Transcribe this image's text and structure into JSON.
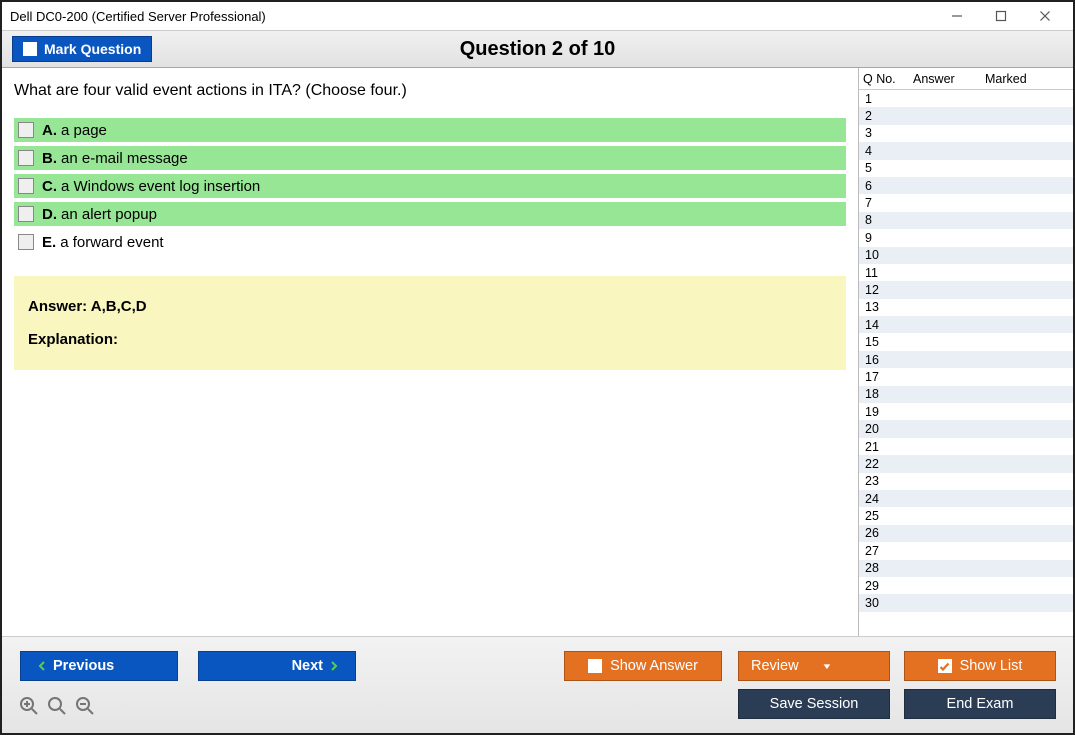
{
  "window": {
    "title": "Dell DC0-200 (Certified Server Professional)"
  },
  "header": {
    "mark_label": "Mark Question",
    "counter": "Question 2 of 10"
  },
  "question": {
    "text": "What are four valid event actions in ITA? (Choose four.)",
    "choices": [
      {
        "letter": "A.",
        "text": "a page",
        "correct": true
      },
      {
        "letter": "B.",
        "text": "an e-mail message",
        "correct": true
      },
      {
        "letter": "C.",
        "text": "a Windows event log insertion",
        "correct": true
      },
      {
        "letter": "D.",
        "text": "an alert popup",
        "correct": true
      },
      {
        "letter": "E.",
        "text": "a forward event",
        "correct": false
      }
    ],
    "answer_label": "Answer: A,B,C,D",
    "explanation_label": "Explanation:"
  },
  "sidebar": {
    "head_q": "Q No.",
    "head_a": "Answer",
    "head_m": "Marked",
    "rows": [
      {
        "n": "1"
      },
      {
        "n": "2"
      },
      {
        "n": "3"
      },
      {
        "n": "4"
      },
      {
        "n": "5"
      },
      {
        "n": "6"
      },
      {
        "n": "7"
      },
      {
        "n": "8"
      },
      {
        "n": "9"
      },
      {
        "n": "10"
      },
      {
        "n": "11"
      },
      {
        "n": "12"
      },
      {
        "n": "13"
      },
      {
        "n": "14"
      },
      {
        "n": "15"
      },
      {
        "n": "16"
      },
      {
        "n": "17"
      },
      {
        "n": "18"
      },
      {
        "n": "19"
      },
      {
        "n": "20"
      },
      {
        "n": "21"
      },
      {
        "n": "22"
      },
      {
        "n": "23"
      },
      {
        "n": "24"
      },
      {
        "n": "25"
      },
      {
        "n": "26"
      },
      {
        "n": "27"
      },
      {
        "n": "28"
      },
      {
        "n": "29"
      },
      {
        "n": "30"
      }
    ]
  },
  "footer": {
    "previous": "Previous",
    "next": "Next",
    "show_answer": "Show Answer",
    "review": "Review",
    "show_list": "Show List",
    "save_session": "Save Session",
    "end_exam": "End Exam"
  }
}
